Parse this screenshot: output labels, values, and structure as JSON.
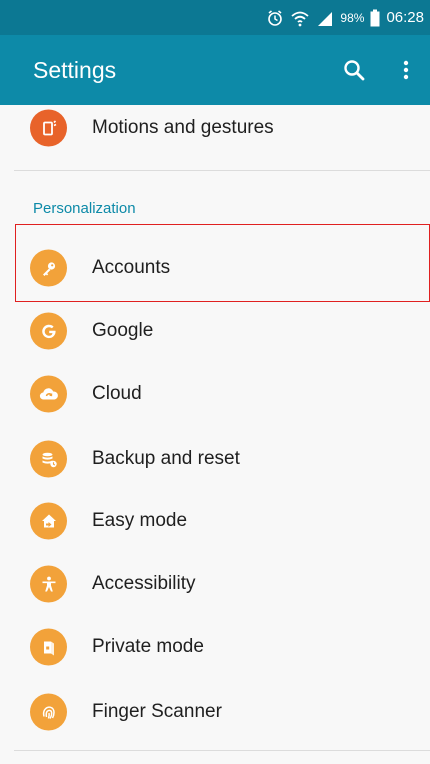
{
  "status_bar": {
    "battery_percent": "98%",
    "time": "06:28",
    "icons": [
      "alarm-icon",
      "wifi-icon",
      "signal-icon",
      "battery-icon"
    ]
  },
  "app_bar": {
    "title": "Settings",
    "actions": [
      "search-icon",
      "more-vertical-icon"
    ]
  },
  "list": {
    "top_item": {
      "label": "Motions and gestures",
      "icon": "motions-icon",
      "color": "#e8632a"
    },
    "section_header": "Personalization",
    "items": [
      {
        "label": "Accounts",
        "icon": "key-icon"
      },
      {
        "label": "Google",
        "icon": "google-icon"
      },
      {
        "label": "Cloud",
        "icon": "cloud-icon"
      },
      {
        "label": "Backup and reset",
        "icon": "backup-icon"
      },
      {
        "label": "Easy mode",
        "icon": "easy-mode-icon"
      },
      {
        "label": "Accessibility",
        "icon": "accessibility-icon"
      },
      {
        "label": "Private mode",
        "icon": "private-mode-icon"
      },
      {
        "label": "Finger Scanner",
        "icon": "fingerprint-icon"
      }
    ]
  },
  "colors": {
    "status_bar": "#0c7893",
    "app_bar": "#0d8aa8",
    "item_icon": "#f2a23a",
    "highlight": "#e02020"
  }
}
